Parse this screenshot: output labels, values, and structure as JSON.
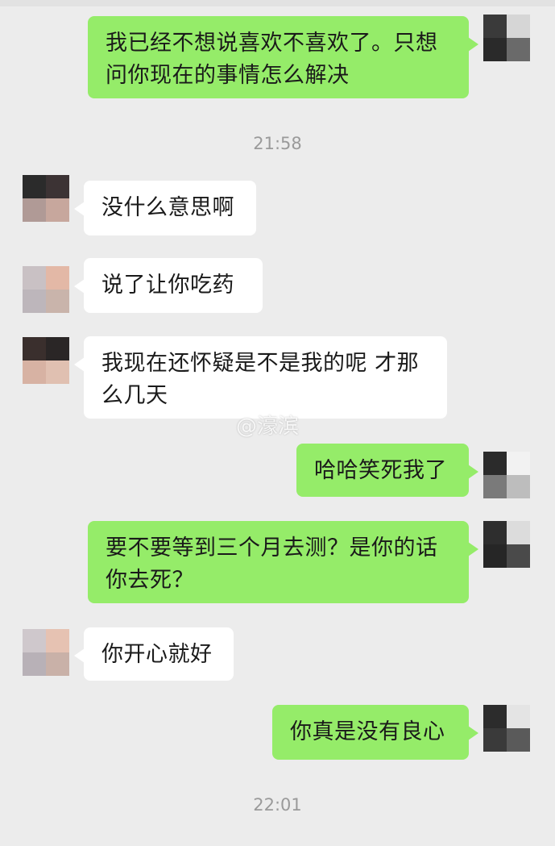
{
  "colors": {
    "background": "#ececec",
    "outgoing_bubble": "#95ec69",
    "incoming_bubble": "#ffffff",
    "timestamp_text": "#9a9a9a"
  },
  "messages": [
    {
      "direction": "out",
      "line1": "我已经不想说喜欢不喜欢了。只想",
      "line2": "问你现在的事情怎么解决"
    },
    {
      "direction": "in",
      "text": "没什么意思啊"
    },
    {
      "direction": "in",
      "text": "说了让你吃药"
    },
    {
      "direction": "in",
      "line1": "我现在还怀疑是不是我的呢 才那",
      "line2": "么几天"
    },
    {
      "direction": "out",
      "text": "哈哈笑死我了"
    },
    {
      "direction": "out",
      "line1": "要不要等到三个月去测？是你的话",
      "line2": "你去死？"
    },
    {
      "direction": "in",
      "text": "你开心就好"
    },
    {
      "direction": "out",
      "text": "你真是没有良心"
    }
  ],
  "timestamps": [
    "21:58",
    "22:01"
  ],
  "watermark": "@濠滨",
  "avatars": {
    "self": "pixelated-avatar",
    "other": "pixelated-avatar"
  }
}
